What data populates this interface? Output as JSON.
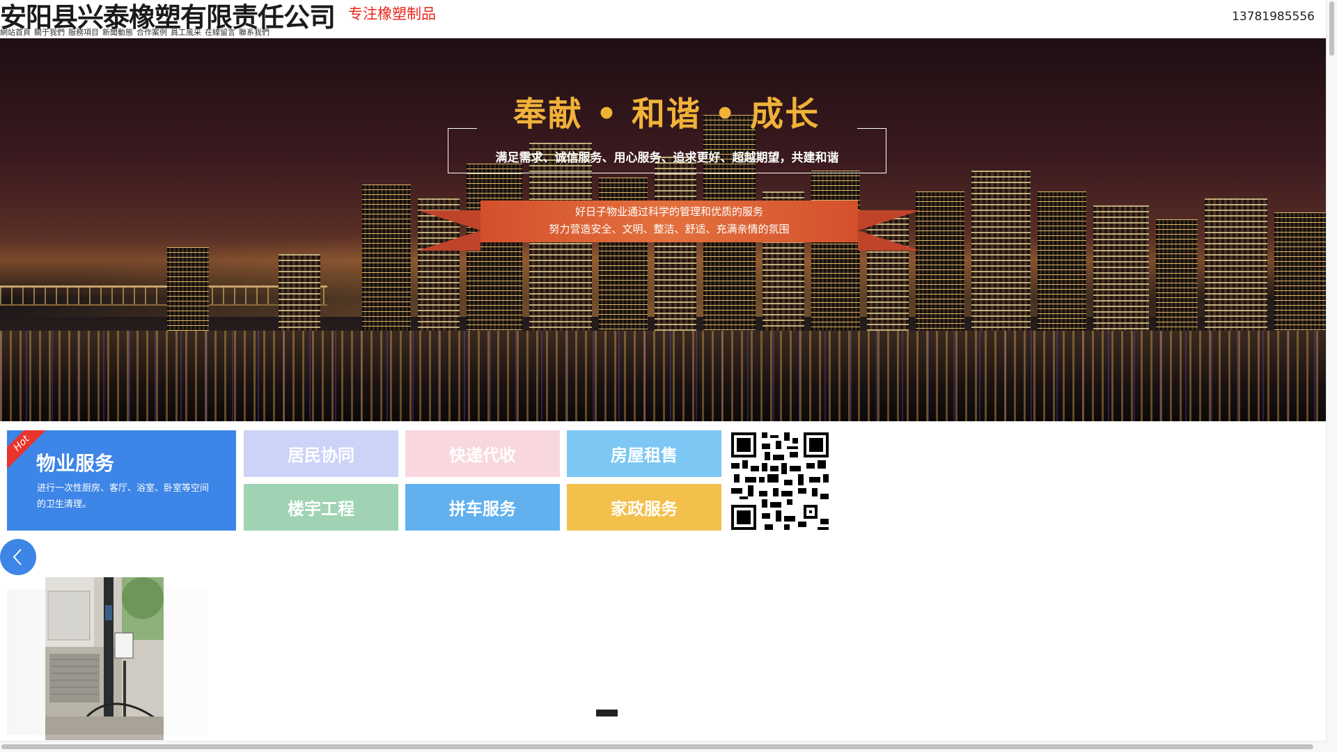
{
  "header": {
    "company_name": "安阳县兴泰橡塑有限责任公司",
    "slogan": "专注橡塑制品",
    "phone": "13781985556",
    "nav": [
      "網站首頁",
      "關于我們",
      "服務項目",
      "新聞動態",
      "合作案例",
      "員工風采",
      "在線留言",
      "聯系我們"
    ]
  },
  "banner": {
    "title": "奉献 • 和谐 • 成长",
    "subtitle": "满足需求、诚信服务、用心服务、追求更好、超越期望，共建和谐",
    "ribbon_line1": "好日子物业通过科学的管理和优质的服务",
    "ribbon_line2": "努力营造安全、文明、整洁、舒适、充满亲情的氛围"
  },
  "services": {
    "hot_tag": "Hot",
    "hot_title": "物业服务",
    "hot_desc": "进行一次性厨房、客厅、浴室、卧室等空间的卫生清理。",
    "tiles": [
      {
        "label": "居民协同",
        "color": "#ccd3f7"
      },
      {
        "label": "快递代收",
        "color": "#f8d8de"
      },
      {
        "label": "房屋租售",
        "color": "#7cc7f4"
      },
      {
        "label": "楼宇工程",
        "color": "#9fd3b3"
      },
      {
        "label": "拼车服务",
        "color": "#62b1ee"
      },
      {
        "label": "家政服务",
        "color": "#f3c04b"
      }
    ]
  },
  "colors": {
    "accent_blue": "#3d85e6",
    "slogan_red": "#e8261a",
    "banner_gold": "#f0b239",
    "ribbon_orange": "#d4502c"
  },
  "icons": {
    "prev": "chevron-left-icon",
    "qr": "qr-code-icon"
  }
}
